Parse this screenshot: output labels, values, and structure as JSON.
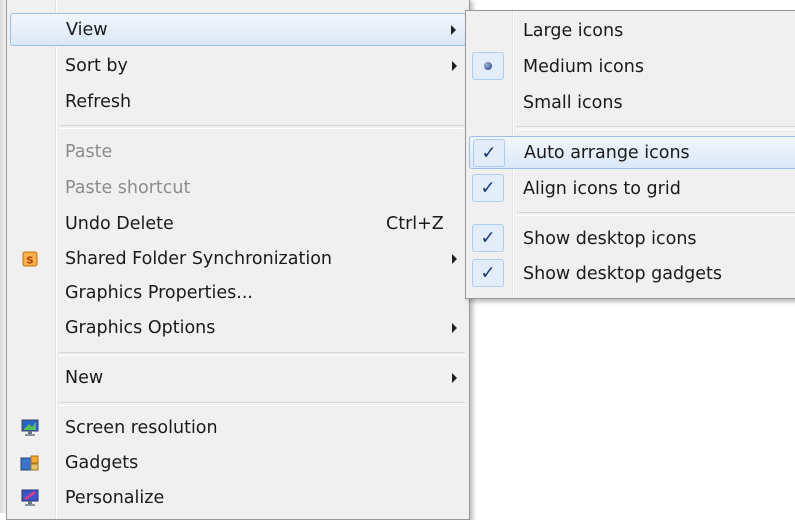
{
  "context_menu": {
    "items": [
      {
        "label": "View",
        "submenu": true,
        "highlighted": true
      },
      {
        "label": "Sort by",
        "submenu": true
      },
      {
        "label": "Refresh"
      },
      {
        "label": "Paste",
        "disabled": true
      },
      {
        "label": "Paste shortcut",
        "disabled": true
      },
      {
        "label": "Undo Delete",
        "shortcut": "Ctrl+Z"
      },
      {
        "label": "Shared Folder Synchronization",
        "submenu": true,
        "icon": "shared-folder-sync-icon",
        "icon_glyph": "S"
      },
      {
        "label": "Graphics Properties..."
      },
      {
        "label": "Graphics Options",
        "submenu": true
      },
      {
        "label": "New",
        "submenu": true
      },
      {
        "label": "Screen resolution",
        "icon": "monitor-icon"
      },
      {
        "label": "Gadgets",
        "icon": "gadgets-icon"
      },
      {
        "label": "Personalize",
        "icon": "personalize-icon"
      }
    ]
  },
  "view_submenu": {
    "items": [
      {
        "label": "Large icons"
      },
      {
        "label": "Medium icons",
        "selected": true,
        "mark": "radio"
      },
      {
        "label": "Small icons"
      },
      {
        "label": "Auto arrange icons",
        "checked": true,
        "highlighted": true,
        "mark_glyph": "✓"
      },
      {
        "label": "Align icons to grid",
        "checked": true,
        "mark_glyph": "✓"
      },
      {
        "label": "Show desktop icons",
        "checked": true,
        "mark_glyph": "✓"
      },
      {
        "label": "Show desktop gadgets",
        "checked": true,
        "mark_glyph": "✓"
      }
    ]
  },
  "colors": {
    "menu_bg": "#f0f0f0",
    "highlight_border": "#9ebde9",
    "disabled_text": "#8c8c8c",
    "check_color": "#143a7a"
  }
}
